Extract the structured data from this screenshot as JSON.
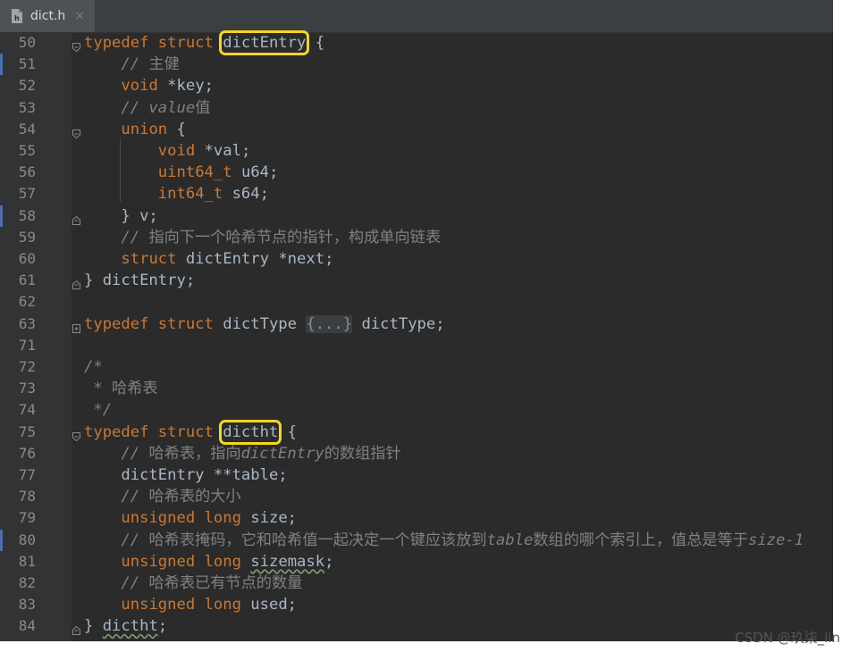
{
  "tab": {
    "filename": "dict.h",
    "file_icon": "c-header-file-icon",
    "close_icon": "close-icon",
    "close_glyph": "×"
  },
  "watermark": "CSDN @玖柒_lin",
  "code_lines": [
    {
      "num": "50",
      "segments": [
        {
          "text": "typedef struct ",
          "cls": "kw"
        },
        {
          "text": "dictEntry",
          "cls": "hl"
        },
        {
          "text": " {",
          "cls": ""
        }
      ]
    },
    {
      "num": "51",
      "segments": [
        {
          "text": "    // ",
          "cls": "cm"
        },
        {
          "text": "主健",
          "cls": "cm zh"
        }
      ]
    },
    {
      "num": "52",
      "segments": [
        {
          "text": "    ",
          "cls": ""
        },
        {
          "text": "void",
          "cls": "kw"
        },
        {
          "text": " *key;",
          "cls": ""
        }
      ]
    },
    {
      "num": "53",
      "segments": [
        {
          "text": "    // value",
          "cls": "cm"
        },
        {
          "text": "值",
          "cls": "cm zh"
        }
      ]
    },
    {
      "num": "54",
      "segments": [
        {
          "text": "    ",
          "cls": ""
        },
        {
          "text": "union",
          "cls": "kw"
        },
        {
          "text": " {",
          "cls": ""
        }
      ]
    },
    {
      "num": "55",
      "segments": [
        {
          "text": "        ",
          "cls": ""
        },
        {
          "text": "void",
          "cls": "kw"
        },
        {
          "text": " *val;",
          "cls": ""
        }
      ]
    },
    {
      "num": "56",
      "segments": [
        {
          "text": "        ",
          "cls": ""
        },
        {
          "text": "uint64_t",
          "cls": "kw"
        },
        {
          "text": " u64;",
          "cls": ""
        }
      ]
    },
    {
      "num": "57",
      "segments": [
        {
          "text": "        ",
          "cls": ""
        },
        {
          "text": "int64_t",
          "cls": "kw"
        },
        {
          "text": " s64;",
          "cls": ""
        }
      ]
    },
    {
      "num": "58",
      "segments": [
        {
          "text": "    } v;",
          "cls": ""
        }
      ]
    },
    {
      "num": "59",
      "segments": [
        {
          "text": "    // ",
          "cls": "cm"
        },
        {
          "text": "指向下一个哈希节点的指针，构成单向链表",
          "cls": "cm zh"
        }
      ]
    },
    {
      "num": "60",
      "segments": [
        {
          "text": "    ",
          "cls": ""
        },
        {
          "text": "struct",
          "cls": "kw"
        },
        {
          "text": " dictEntry *next;",
          "cls": ""
        }
      ]
    },
    {
      "num": "61",
      "segments": [
        {
          "text": "} dictEntry;",
          "cls": ""
        }
      ]
    },
    {
      "num": "62",
      "segments": []
    },
    {
      "num": "63",
      "segments": [
        {
          "text": "typedef struct ",
          "cls": "kw"
        },
        {
          "text": "dictType ",
          "cls": ""
        },
        {
          "text": "{...}",
          "cls": "fold-ph"
        },
        {
          "text": " dictType;",
          "cls": ""
        }
      ]
    },
    {
      "num": "71",
      "segments": []
    },
    {
      "num": "72",
      "segments": [
        {
          "text": "/*",
          "cls": "cm"
        }
      ]
    },
    {
      "num": "73",
      "segments": [
        {
          "text": " * ",
          "cls": "cm"
        },
        {
          "text": "哈希表",
          "cls": "cm zh"
        }
      ]
    },
    {
      "num": "74",
      "segments": [
        {
          "text": " */",
          "cls": "cm"
        }
      ]
    },
    {
      "num": "75",
      "segments": [
        {
          "text": "typedef struct ",
          "cls": "kw"
        },
        {
          "text": "dictht",
          "cls": "hl"
        },
        {
          "text": " {",
          "cls": ""
        }
      ]
    },
    {
      "num": "76",
      "segments": [
        {
          "text": "    // ",
          "cls": "cm"
        },
        {
          "text": "哈希表，指向",
          "cls": "cm zh"
        },
        {
          "text": "dictEntry",
          "cls": "cm"
        },
        {
          "text": "的数组指针",
          "cls": "cm zh"
        }
      ]
    },
    {
      "num": "77",
      "segments": [
        {
          "text": "    dictEntry **table;",
          "cls": ""
        }
      ]
    },
    {
      "num": "78",
      "segments": [
        {
          "text": "    // ",
          "cls": "cm"
        },
        {
          "text": "哈希表的大小",
          "cls": "cm zh"
        }
      ]
    },
    {
      "num": "79",
      "segments": [
        {
          "text": "    ",
          "cls": ""
        },
        {
          "text": "unsigned long",
          "cls": "kw"
        },
        {
          "text": " size;",
          "cls": ""
        }
      ]
    },
    {
      "num": "80",
      "segments": [
        {
          "text": "    // ",
          "cls": "cm"
        },
        {
          "text": "哈希表掩码，它和哈希值一起决定一个键应该放到",
          "cls": "cm zh"
        },
        {
          "text": "table",
          "cls": "cm"
        },
        {
          "text": "数组的哪个索引上，值总是等于",
          "cls": "cm zh"
        },
        {
          "text": "size-1",
          "cls": "cm"
        }
      ]
    },
    {
      "num": "81",
      "segments": [
        {
          "text": "    ",
          "cls": ""
        },
        {
          "text": "unsigned long",
          "cls": "kw"
        },
        {
          "text": " ",
          "cls": ""
        },
        {
          "text": "sizemask",
          "cls": "wavy"
        },
        {
          "text": ";",
          "cls": ""
        }
      ]
    },
    {
      "num": "82",
      "segments": [
        {
          "text": "    // ",
          "cls": "cm"
        },
        {
          "text": "哈希表已有节点的数量",
          "cls": "cm zh"
        }
      ]
    },
    {
      "num": "83",
      "segments": [
        {
          "text": "    ",
          "cls": ""
        },
        {
          "text": "unsigned long",
          "cls": "kw"
        },
        {
          "text": " used;",
          "cls": ""
        }
      ]
    },
    {
      "num": "84",
      "segments": [
        {
          "text": "} ",
          "cls": ""
        },
        {
          "text": "dictht",
          "cls": "wavy"
        },
        {
          "text": ";",
          "cls": ""
        }
      ]
    }
  ],
  "fold_markers": [
    {
      "line": "50",
      "icon": "fold-open-icon"
    },
    {
      "line": "54",
      "icon": "fold-open-icon"
    },
    {
      "line": "58",
      "icon": "fold-close-icon"
    },
    {
      "line": "61",
      "icon": "fold-close-icon"
    },
    {
      "line": "63",
      "icon": "fold-collapsed-icon"
    },
    {
      "line": "75",
      "icon": "fold-open-icon"
    },
    {
      "line": "84",
      "icon": "fold-close-icon"
    }
  ],
  "change_marks": [
    "51",
    "58",
    "80"
  ]
}
